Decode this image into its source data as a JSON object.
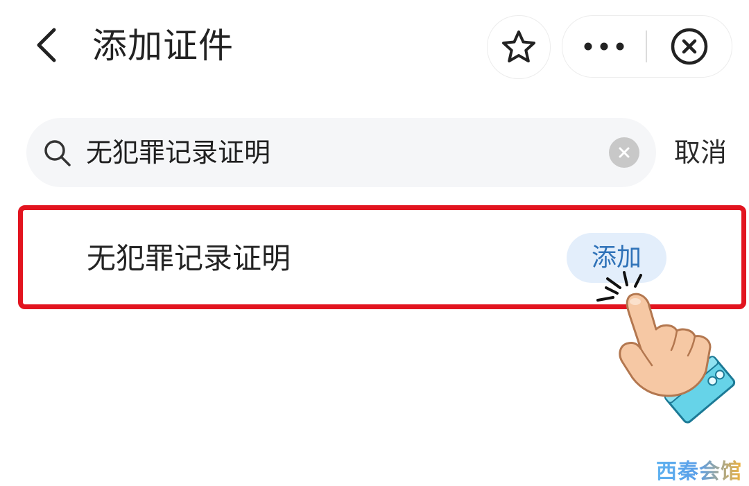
{
  "header": {
    "title": "添加证件",
    "icons": {
      "back": "chevron-left-icon",
      "favorite": "star-icon",
      "more": "more-dots-icon",
      "close": "close-circle-icon"
    }
  },
  "search": {
    "value": "无犯罪记录证明",
    "cancel_label": "取消",
    "icons": {
      "search": "search-icon",
      "clear": "clear-icon"
    }
  },
  "result": {
    "label": "无犯罪记录证明",
    "add_label": "添加",
    "highlight_color": "#e2141f",
    "add_button_color": "#2f72b8"
  },
  "watermark": {
    "text": "西秦会馆"
  }
}
